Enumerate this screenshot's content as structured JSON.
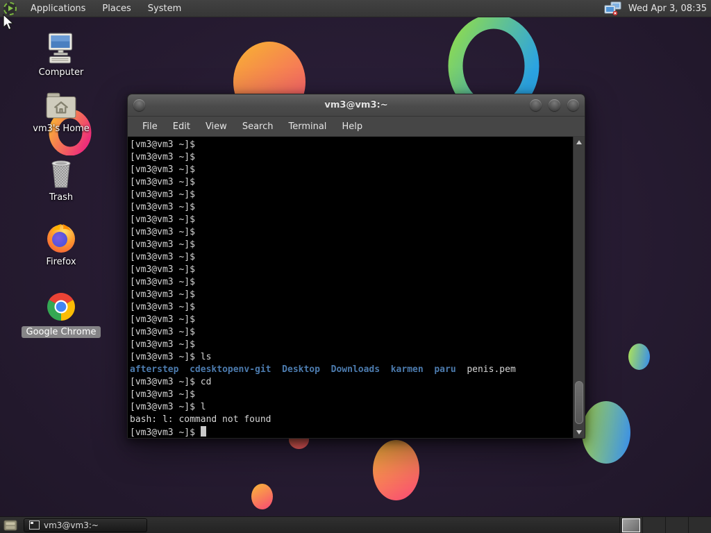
{
  "top_panel": {
    "logo_icon": "distro-menu-icon",
    "menus": [
      {
        "label": "Applications"
      },
      {
        "label": "Places"
      },
      {
        "label": "System"
      }
    ],
    "tray_icon": "network-monitors-icon",
    "clock": "Wed Apr 3, 08:35"
  },
  "desktop": {
    "icons": [
      {
        "label": "Computer",
        "icon": "computer-icon",
        "selected": false
      },
      {
        "label": "vm3's Home",
        "icon": "home-folder-icon",
        "selected": false
      },
      {
        "label": "Trash",
        "icon": "trash-icon",
        "selected": false
      },
      {
        "label": "Firefox",
        "icon": "firefox-icon",
        "selected": false
      },
      {
        "label": "Google Chrome",
        "icon": "chrome-icon",
        "selected": true
      }
    ]
  },
  "terminal_window": {
    "title": "vm3@vm3:~",
    "menu_items": [
      {
        "label": "File"
      },
      {
        "label": "Edit"
      },
      {
        "label": "View"
      },
      {
        "label": "Search"
      },
      {
        "label": "Terminal"
      },
      {
        "label": "Help"
      }
    ],
    "colors": {
      "background": "#000000",
      "foreground": "#d6d6d6",
      "directory_blue": "#4c7bae",
      "cursor": "#c9c9c9"
    },
    "prompt": "[vm3@vm3 ~]$",
    "lines": [
      {
        "segments": [
          {
            "text": "[vm3@vm3 ~]$",
            "style": "plain"
          }
        ]
      },
      {
        "segments": [
          {
            "text": "[vm3@vm3 ~]$",
            "style": "plain"
          }
        ]
      },
      {
        "segments": [
          {
            "text": "[vm3@vm3 ~]$",
            "style": "plain"
          }
        ]
      },
      {
        "segments": [
          {
            "text": "[vm3@vm3 ~]$",
            "style": "plain"
          }
        ]
      },
      {
        "segments": [
          {
            "text": "[vm3@vm3 ~]$",
            "style": "plain"
          }
        ]
      },
      {
        "segments": [
          {
            "text": "[vm3@vm3 ~]$",
            "style": "plain"
          }
        ]
      },
      {
        "segments": [
          {
            "text": "[vm3@vm3 ~]$",
            "style": "plain"
          }
        ]
      },
      {
        "segments": [
          {
            "text": "[vm3@vm3 ~]$",
            "style": "plain"
          }
        ]
      },
      {
        "segments": [
          {
            "text": "[vm3@vm3 ~]$",
            "style": "plain"
          }
        ]
      },
      {
        "segments": [
          {
            "text": "[vm3@vm3 ~]$",
            "style": "plain"
          }
        ]
      },
      {
        "segments": [
          {
            "text": "[vm3@vm3 ~]$",
            "style": "plain"
          }
        ]
      },
      {
        "segments": [
          {
            "text": "[vm3@vm3 ~]$",
            "style": "plain"
          }
        ]
      },
      {
        "segments": [
          {
            "text": "[vm3@vm3 ~]$",
            "style": "plain"
          }
        ]
      },
      {
        "segments": [
          {
            "text": "[vm3@vm3 ~]$",
            "style": "plain"
          }
        ]
      },
      {
        "segments": [
          {
            "text": "[vm3@vm3 ~]$",
            "style": "plain"
          }
        ]
      },
      {
        "segments": [
          {
            "text": "[vm3@vm3 ~]$",
            "style": "plain"
          }
        ]
      },
      {
        "segments": [
          {
            "text": "[vm3@vm3 ~]$",
            "style": "plain"
          }
        ]
      },
      {
        "segments": [
          {
            "text": "[vm3@vm3 ~]$ ls",
            "style": "plain"
          }
        ]
      },
      {
        "segments": [
          {
            "text": "afterstep",
            "style": "dir"
          },
          {
            "text": "  ",
            "style": "plain"
          },
          {
            "text": "cdesktopenv-git",
            "style": "dir"
          },
          {
            "text": "  ",
            "style": "plain"
          },
          {
            "text": "Desktop",
            "style": "dir"
          },
          {
            "text": "  ",
            "style": "plain"
          },
          {
            "text": "Downloads",
            "style": "dir"
          },
          {
            "text": "  ",
            "style": "plain"
          },
          {
            "text": "karmen",
            "style": "dir"
          },
          {
            "text": "  ",
            "style": "plain"
          },
          {
            "text": "paru",
            "style": "dir"
          },
          {
            "text": "  ",
            "style": "plain"
          },
          {
            "text": "penis.pem",
            "style": "plain"
          }
        ]
      },
      {
        "segments": [
          {
            "text": "[vm3@vm3 ~]$ cd",
            "style": "plain"
          }
        ]
      },
      {
        "segments": [
          {
            "text": "[vm3@vm3 ~]$",
            "style": "plain"
          }
        ]
      },
      {
        "segments": [
          {
            "text": "[vm3@vm3 ~]$ l",
            "style": "plain"
          }
        ]
      },
      {
        "segments": [
          {
            "text": "bash: l: command not found",
            "style": "plain"
          }
        ]
      },
      {
        "segments": [
          {
            "text": "[vm3@vm3 ~]$ ",
            "style": "plain"
          }
        ],
        "cursor": true
      }
    ]
  },
  "taskbar": {
    "show_desktop_icon": "drawer-icon",
    "window_button": {
      "label": "vm3@vm3:~",
      "icon": "terminal-icon",
      "active": true
    },
    "workspace_switcher": {
      "count": 4,
      "active": 0
    }
  },
  "wallpaper": {
    "base_color": "#261b31",
    "shape_colors": {
      "orange_start": "#f7a53a",
      "orange_end": "#f4566f",
      "teal_start": "#a9df5c",
      "teal_end": "#3a8fe8",
      "green_ring_start": "#8fdc4d",
      "green_ring_end": "#2ba3e2",
      "pink_ring_start": "#f9a93a",
      "pink_ring_end": "#ee2d7a"
    }
  }
}
